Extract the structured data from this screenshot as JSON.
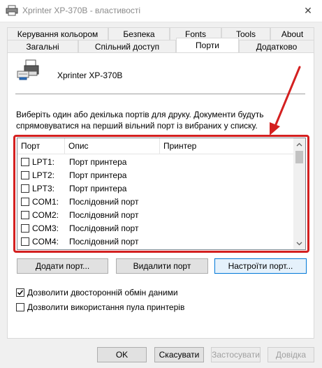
{
  "window": {
    "title": "Xprinter XP-370B - властивості",
    "close_glyph": "✕"
  },
  "tabs_top": [
    {
      "label": "Керування кольором"
    },
    {
      "label": "Безпека"
    },
    {
      "label": "Fonts"
    },
    {
      "label": "Tools"
    },
    {
      "label": "About"
    }
  ],
  "tabs_bottom": [
    {
      "label": "Загальні"
    },
    {
      "label": "Спільний доступ"
    },
    {
      "label": "Порти",
      "active": true
    },
    {
      "label": "Додатково"
    }
  ],
  "printer": {
    "name": "Xprinter XP-370B"
  },
  "description": "Виберіть один або декілька портів для друку. Документи будуть спрямовуватися на перший вільний порт із вибраних у списку.",
  "ports": {
    "headers": [
      "Порт",
      "Опис",
      "Принтер"
    ],
    "rows": [
      {
        "port": "LPT1:",
        "desc": "Порт принтера",
        "printer": "",
        "checked": false
      },
      {
        "port": "LPT2:",
        "desc": "Порт принтера",
        "printer": "",
        "checked": false
      },
      {
        "port": "LPT3:",
        "desc": "Порт принтера",
        "printer": "",
        "checked": false
      },
      {
        "port": "COM1:",
        "desc": "Послідовний порт",
        "printer": "",
        "checked": false
      },
      {
        "port": "COM2:",
        "desc": "Послідовний порт",
        "printer": "",
        "checked": false
      },
      {
        "port": "COM3:",
        "desc": "Послідовний порт",
        "printer": "",
        "checked": false
      },
      {
        "port": "COM4:",
        "desc": "Послідовний порт",
        "printer": "",
        "checked": false
      }
    ]
  },
  "port_buttons": {
    "add": "Додати порт...",
    "delete": "Видалити порт",
    "configure": "Настроїти порт..."
  },
  "options": {
    "bidirectional": {
      "label": "Дозволити двосторонній обмін даними",
      "checked": true
    },
    "pooling": {
      "label": "Дозволити використання пула принтерів",
      "checked": false
    }
  },
  "dialog_buttons": {
    "ok": "OK",
    "cancel": "Скасувати",
    "apply": "Застосувати",
    "help": "Довідка"
  },
  "colors": {
    "highlight": "#d42020",
    "focus": "#0078d7"
  },
  "icons": {
    "title": "printer-icon",
    "header": "printer-icon",
    "annotation": "red-arrow-icon"
  }
}
